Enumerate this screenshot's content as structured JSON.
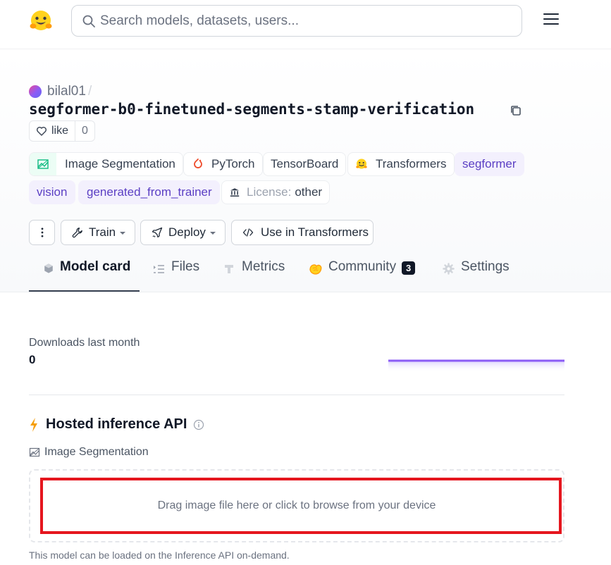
{
  "nav": {
    "logo_name": "hugging-face-logo",
    "search_placeholder": "Search models, datasets, users..."
  },
  "model": {
    "owner": "bilal01",
    "separator": "/",
    "name": "segformer-b0-finetuned-segments-stamp-verification",
    "like_label": "like",
    "like_count": "0"
  },
  "tags": [
    {
      "label": "Image Segmentation",
      "icon": "image-segmentation-icon"
    },
    {
      "label": "PyTorch",
      "icon": "pytorch-icon"
    },
    {
      "label": "TensorBoard"
    },
    {
      "label": "Transformers",
      "icon": "hugging-face-icon"
    },
    {
      "label": "segformer"
    },
    {
      "label": "vision"
    },
    {
      "label": "generated_from_trainer"
    },
    {
      "label_prefix": "License:",
      "label": "other",
      "icon": "bank-icon"
    }
  ],
  "actions": {
    "train_label": "Train",
    "deploy_label": "Deploy",
    "use_label": "Use in Transformers"
  },
  "tabs": [
    {
      "label": "Model card",
      "active": true
    },
    {
      "label": "Files"
    },
    {
      "label": "Metrics"
    },
    {
      "label": "Community",
      "badge": "3"
    },
    {
      "label": "Settings"
    }
  ],
  "downloads": {
    "label": "Downloads last month",
    "value": "0"
  },
  "inference": {
    "title": "Hosted inference API",
    "task": "Image Segmentation",
    "dropzone_text": "Drag image file here or click to browse from your device",
    "note": "This model can be loaded on the Inference API on-demand."
  },
  "colors": {
    "accent_purple": "#8b5cf6",
    "tag_purple_bg": "#f3f0fd",
    "tag_purple_text": "#5b3fc4",
    "highlight_red": "#e5161e"
  }
}
